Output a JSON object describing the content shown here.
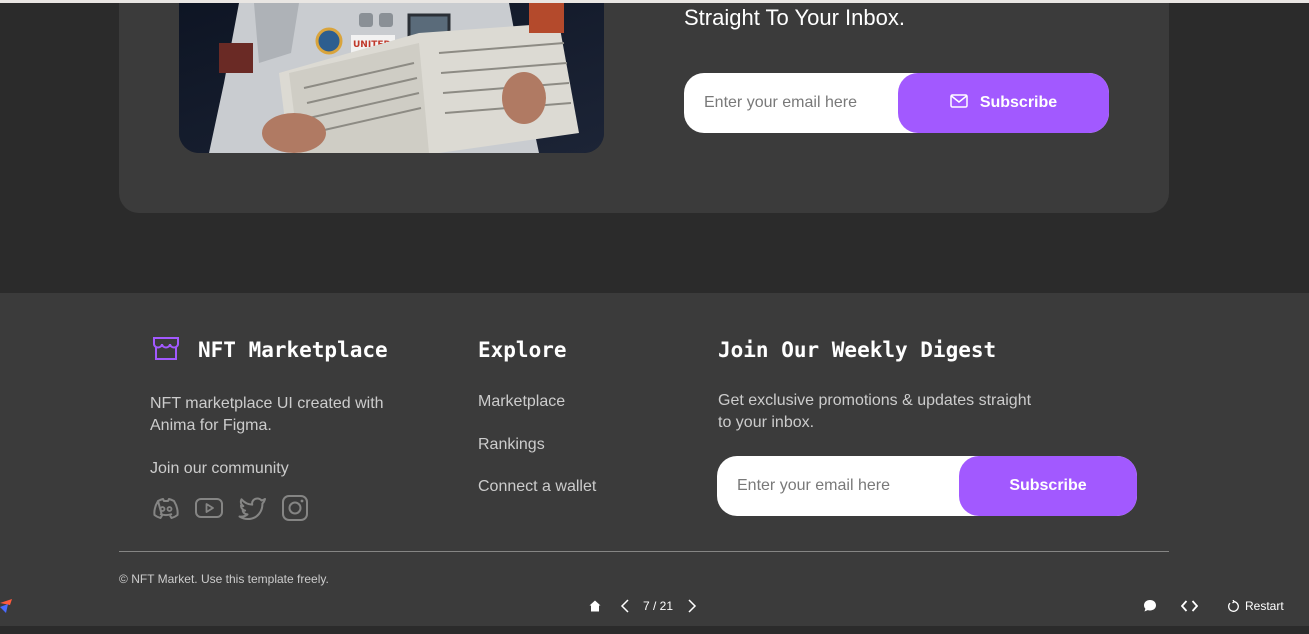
{
  "newsletter_card": {
    "tagline": "Straight To Your Inbox.",
    "email_placeholder": "Enter your email here",
    "subscribe_label": "Subscribe"
  },
  "footer": {
    "brand": {
      "name": "NFT Marketplace",
      "description": "NFT marketplace UI created with Anima for Figma.",
      "community_label": "Join our community",
      "socials": [
        "discord-icon",
        "youtube-icon",
        "twitter-icon",
        "instagram-icon"
      ]
    },
    "explore": {
      "title": "Explore",
      "links": [
        "Marketplace",
        "Rankings",
        "Connect a wallet"
      ]
    },
    "digest": {
      "title": "Join Our Weekly Digest",
      "description": "Get exclusive promotions & updates straight to your inbox.",
      "email_placeholder": "Enter your email here",
      "subscribe_label": "Subscribe"
    },
    "copyright": "NFT Market. Use this template freely."
  },
  "presentation_bar": {
    "page_indicator": "7 / 21",
    "restart_label": "Restart"
  },
  "colors": {
    "accent": "#a259ff",
    "background": "#2b2b2b",
    "surface": "#3b3b3b",
    "muted_text": "#cccccc"
  }
}
